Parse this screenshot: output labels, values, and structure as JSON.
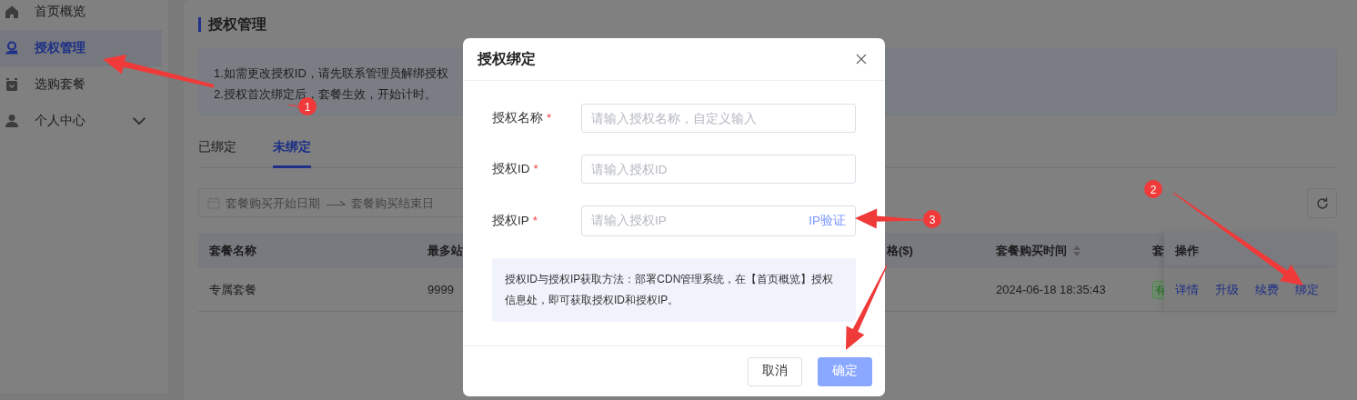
{
  "sidebar": {
    "items": [
      {
        "label": "首页概览",
        "selected": false,
        "kind": "link"
      },
      {
        "label": "授权管理",
        "selected": true,
        "kind": "link"
      },
      {
        "label": "选购套餐",
        "selected": false,
        "kind": "link"
      },
      {
        "label": "个人中心",
        "selected": false,
        "kind": "group"
      }
    ]
  },
  "page": {
    "title": "授权管理",
    "notices": [
      "1.如需更改授权ID，请先联系管理员解绑授权",
      "2.授权首次绑定后，套餐生效，开始计时。"
    ],
    "tabs": [
      {
        "label": "已绑定",
        "selected": false
      },
      {
        "label": "未绑定",
        "selected": true
      }
    ],
    "date_range": {
      "start_placeholder": "套餐购买开始日期",
      "end_placeholder": "套餐购买结束日"
    },
    "table": {
      "columns": [
        {
          "label": "套餐名称",
          "sortable": false
        },
        {
          "label": "最多站",
          "sortable": false
        },
        {
          "label": "格($)",
          "sortable": false
        },
        {
          "label": "套餐购买时间",
          "sortable": true
        },
        {
          "label": "套",
          "sortable": false
        },
        {
          "label": "操作",
          "sortable": false
        }
      ],
      "rows": [
        {
          "cells": [
            "专属套餐",
            "9999",
            "",
            "2024-06-18 18:35:43"
          ],
          "status": "有",
          "actions": [
            "详情",
            "升级",
            "续费",
            "绑定"
          ]
        }
      ]
    }
  },
  "modal": {
    "title": "授权绑定",
    "fields": [
      {
        "label": "授权名称",
        "required_mark": "*",
        "placeholder": "请输入授权名称，自定义输入"
      },
      {
        "label": "授权ID",
        "required_mark": "*",
        "placeholder": "请输入授权ID"
      },
      {
        "label": "授权IP",
        "required_mark": "*",
        "placeholder": "请输入授权IP",
        "addon": "IP验证"
      }
    ],
    "info": "授权ID与授权IP获取方法：部署CDN管理系统，在【首页概览】授权信息处，即可获取授权ID和授权IP。",
    "buttons": [
      {
        "label": "取消",
        "kind": "secondary"
      },
      {
        "label": "确定",
        "kind": "primary"
      }
    ]
  },
  "annotations": [
    {
      "kind": "numbered_arrow",
      "number": "1"
    },
    {
      "kind": "numbered_arrow",
      "number": "2"
    },
    {
      "kind": "numbered_arrow",
      "number": "3"
    },
    {
      "kind": "arrow"
    }
  ]
}
